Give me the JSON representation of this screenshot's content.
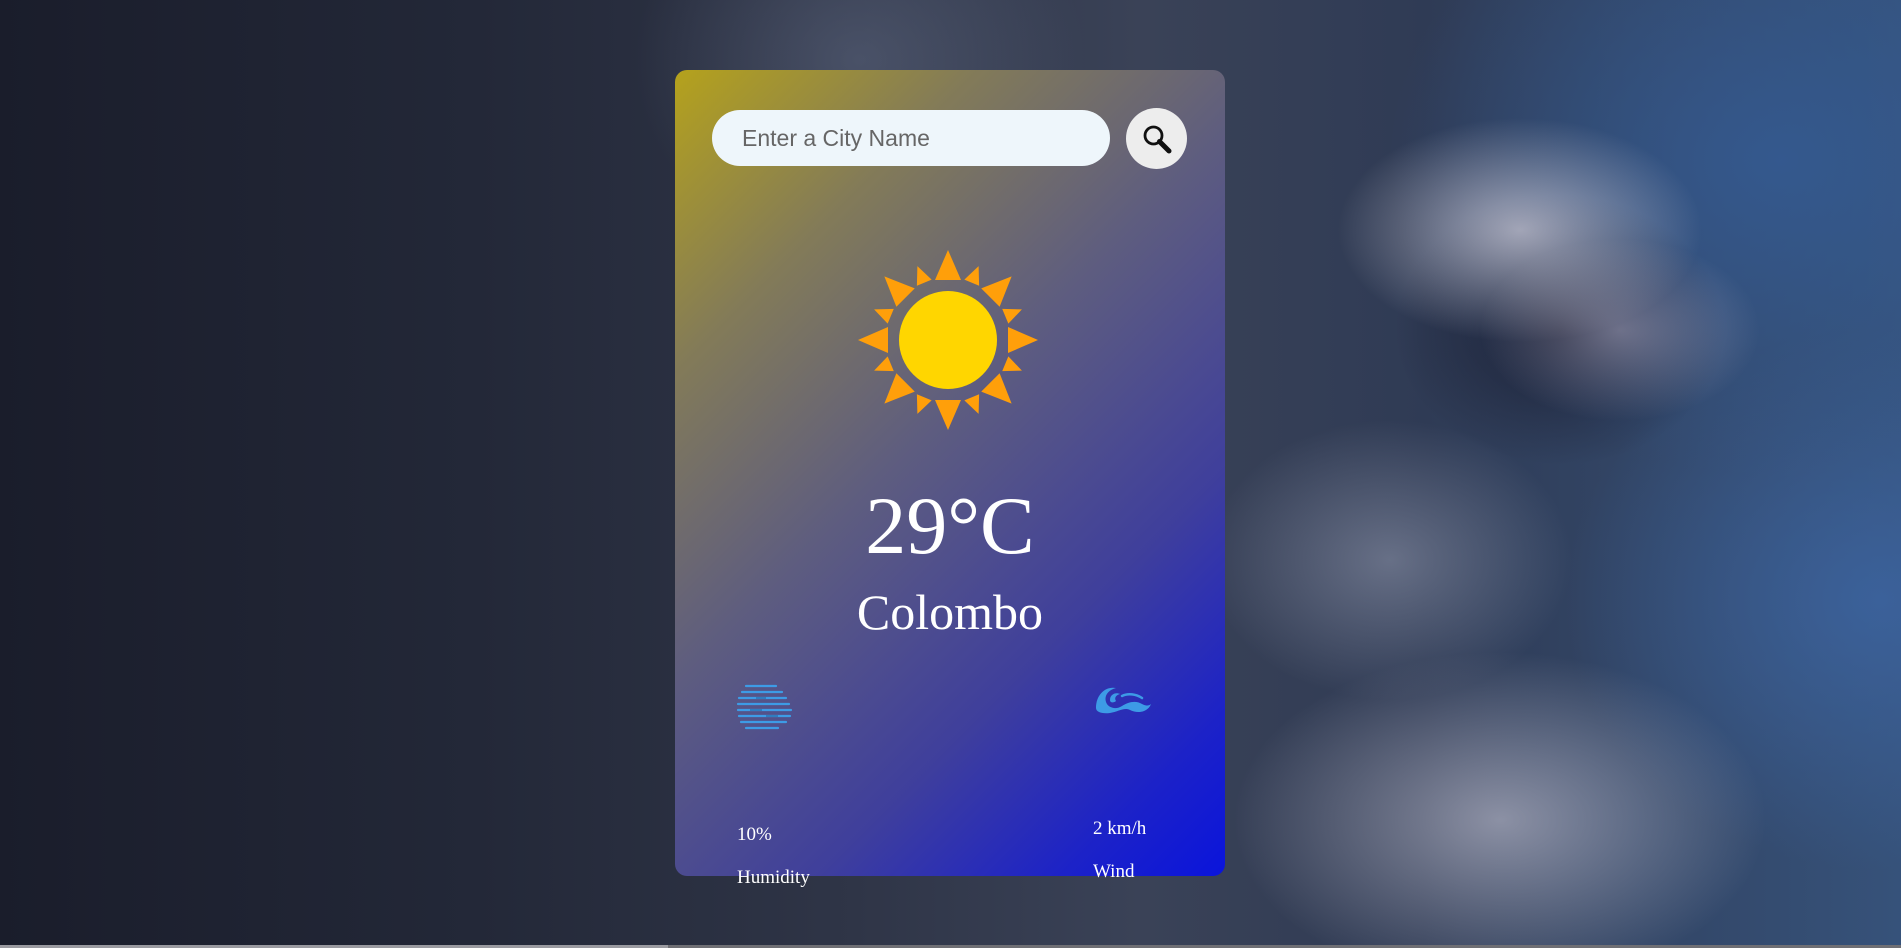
{
  "search": {
    "placeholder": "Enter a City Name",
    "value": "",
    "button_icon": "search-icon"
  },
  "weather": {
    "icon": "sun-icon",
    "temperature": "29°C",
    "city": "Colombo"
  },
  "details": {
    "humidity": {
      "icon": "humidity-icon",
      "value": "10%",
      "label": "Humidity"
    },
    "wind": {
      "icon": "wind-icon",
      "value": "2 km/h",
      "label": "Wind"
    }
  },
  "colors": {
    "card_gradient_start": "#b5a21c",
    "card_gradient_end": "#0a14dc",
    "sun_core": "#ffd600",
    "sun_rays": "#ff9f0a",
    "detail_icon": "#3d9be6",
    "text": "#ffffff"
  }
}
